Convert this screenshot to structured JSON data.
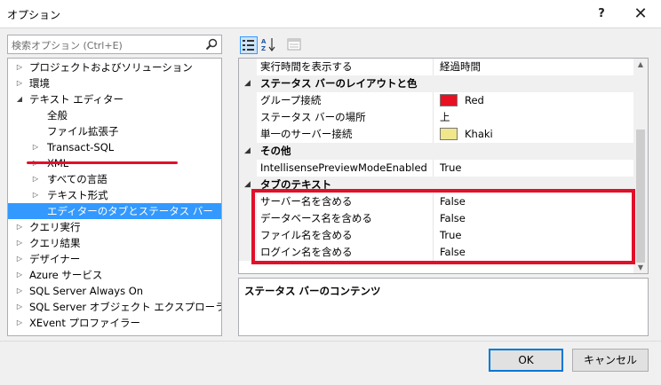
{
  "window": {
    "title": "オプション",
    "help": "?",
    "close": "✕"
  },
  "search": {
    "placeholder": "検索オプション (Ctrl+E)"
  },
  "tree": [
    {
      "label": "プロジェクトおよびソリューション",
      "arrow": "▷"
    },
    {
      "label": "環境",
      "arrow": "▷"
    },
    {
      "label": "テキスト エディター",
      "arrow": "◢"
    },
    {
      "label": "全般",
      "arrow": ""
    },
    {
      "label": "ファイル拡張子",
      "arrow": ""
    },
    {
      "label": "Transact-SQL",
      "arrow": "▷"
    },
    {
      "label": "XML",
      "arrow": "▷"
    },
    {
      "label": "すべての言語",
      "arrow": "▷"
    },
    {
      "label": "テキスト形式",
      "arrow": "▷"
    },
    {
      "label": "エディターのタブとステータス バー",
      "arrow": ""
    },
    {
      "label": "クエリ実行",
      "arrow": "▷"
    },
    {
      "label": "クエリ結果",
      "arrow": "▷"
    },
    {
      "label": "デザイナー",
      "arrow": "▷"
    },
    {
      "label": "Azure サービス",
      "arrow": "▷"
    },
    {
      "label": "SQL Server Always On",
      "arrow": "▷"
    },
    {
      "label": "SQL Server オブジェクト エクスプローラー",
      "arrow": "▷"
    },
    {
      "label": "XEvent プロファイラー",
      "arrow": "▷"
    }
  ],
  "grid": {
    "rows": [
      {
        "name": "実行時間を表示する",
        "value": "経過時間"
      },
      {
        "name": "ステータス バーのレイアウトと色",
        "category": true
      },
      {
        "name": "グループ接続",
        "value": "Red",
        "swatch": "#e81123"
      },
      {
        "name": "ステータス バーの場所",
        "value": "上"
      },
      {
        "name": "単一のサーバー接続",
        "value": "Khaki",
        "swatch": "#f0e68c"
      },
      {
        "name": "その他",
        "category": true
      },
      {
        "name": "IntellisensePreviewModeEnabled",
        "value": "True"
      },
      {
        "name": "タブのテキスト",
        "category": true
      },
      {
        "name": "サーバー名を含める",
        "value": "False"
      },
      {
        "name": "データベース名を含める",
        "value": "False"
      },
      {
        "name": "ファイル名を含める",
        "value": "True"
      },
      {
        "name": "ログイン名を含める",
        "value": "False"
      }
    ]
  },
  "description": {
    "title": "ステータス バーのコンテンツ"
  },
  "buttons": {
    "ok": "OK",
    "cancel": "キャンセル"
  },
  "colors": {
    "selection": "#3399ff",
    "annotation": "#e0102a",
    "ok_border": "#0078d7"
  }
}
